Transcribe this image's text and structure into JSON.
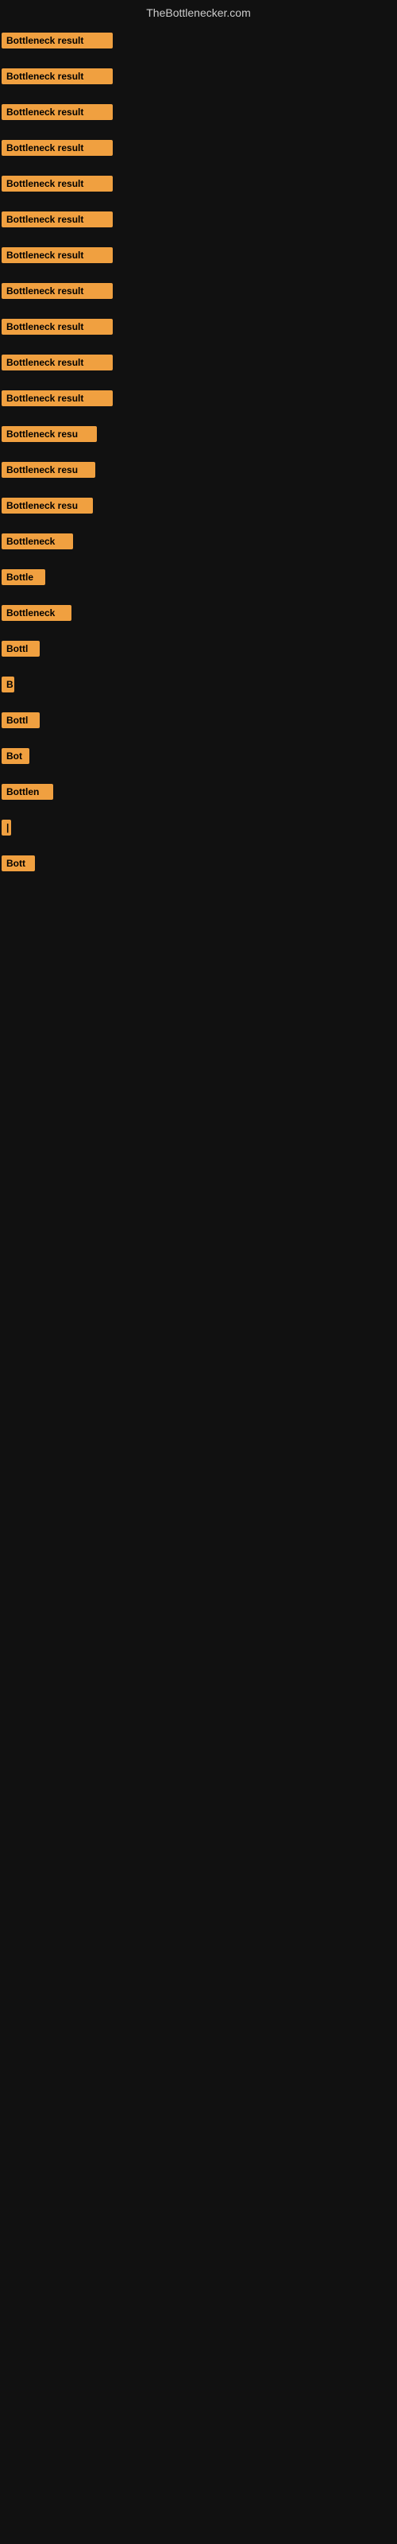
{
  "site": {
    "title": "TheBottlenecker.com"
  },
  "rows": [
    {
      "label": "Bottleneck result",
      "width": 140
    },
    {
      "label": "Bottleneck result",
      "width": 140
    },
    {
      "label": "Bottleneck result",
      "width": 140
    },
    {
      "label": "Bottleneck result",
      "width": 140
    },
    {
      "label": "Bottleneck result",
      "width": 140
    },
    {
      "label": "Bottleneck result",
      "width": 140
    },
    {
      "label": "Bottleneck result",
      "width": 140
    },
    {
      "label": "Bottleneck result",
      "width": 140
    },
    {
      "label": "Bottleneck result",
      "width": 140
    },
    {
      "label": "Bottleneck result",
      "width": 140
    },
    {
      "label": "Bottleneck result",
      "width": 140
    },
    {
      "label": "Bottleneck resu",
      "width": 120
    },
    {
      "label": "Bottleneck resu",
      "width": 118
    },
    {
      "label": "Bottleneck resu",
      "width": 115
    },
    {
      "label": "Bottleneck",
      "width": 90
    },
    {
      "label": "Bottle",
      "width": 55
    },
    {
      "label": "Bottleneck",
      "width": 88
    },
    {
      "label": "Bottl",
      "width": 48
    },
    {
      "label": "B",
      "width": 16
    },
    {
      "label": "Bottl",
      "width": 48
    },
    {
      "label": "Bot",
      "width": 35
    },
    {
      "label": "Bottlen",
      "width": 65
    },
    {
      "label": "|",
      "width": 10
    },
    {
      "label": "Bott",
      "width": 42
    }
  ]
}
